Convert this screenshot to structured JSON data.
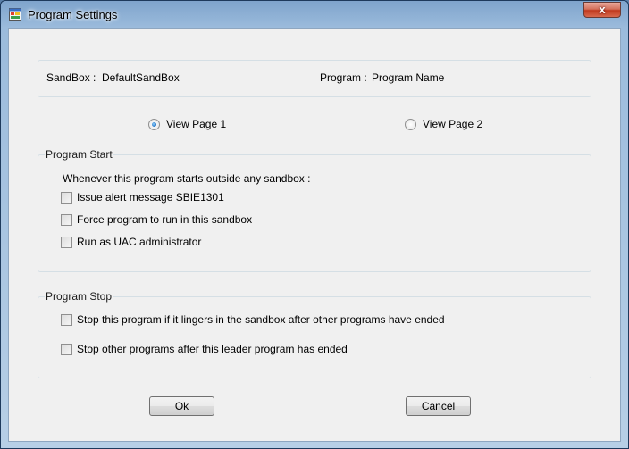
{
  "window": {
    "title": "Program Settings",
    "close_label": "x"
  },
  "info": {
    "sandbox_label": "SandBox :",
    "sandbox_value": "DefaultSandBox",
    "program_label": "Program :",
    "program_value": "Program Name"
  },
  "pages": [
    {
      "label": "View Page 1",
      "selected": true
    },
    {
      "label": "View Page 2",
      "selected": false
    }
  ],
  "program_start": {
    "title": "Program Start",
    "intro": "Whenever this program starts outside any sandbox :",
    "options": [
      {
        "label": "Issue alert message SBIE1301",
        "checked": false
      },
      {
        "label": "Force program to run in this sandbox",
        "checked": false
      },
      {
        "label": "Run as UAC administrator",
        "checked": false
      }
    ]
  },
  "program_stop": {
    "title": "Program Stop",
    "options": [
      {
        "label": "Stop this program if it lingers in the sandbox after other programs have ended",
        "checked": false
      },
      {
        "label": "Stop other programs after this leader program has ended",
        "checked": false
      }
    ]
  },
  "buttons": {
    "ok": "Ok",
    "cancel": "Cancel"
  }
}
